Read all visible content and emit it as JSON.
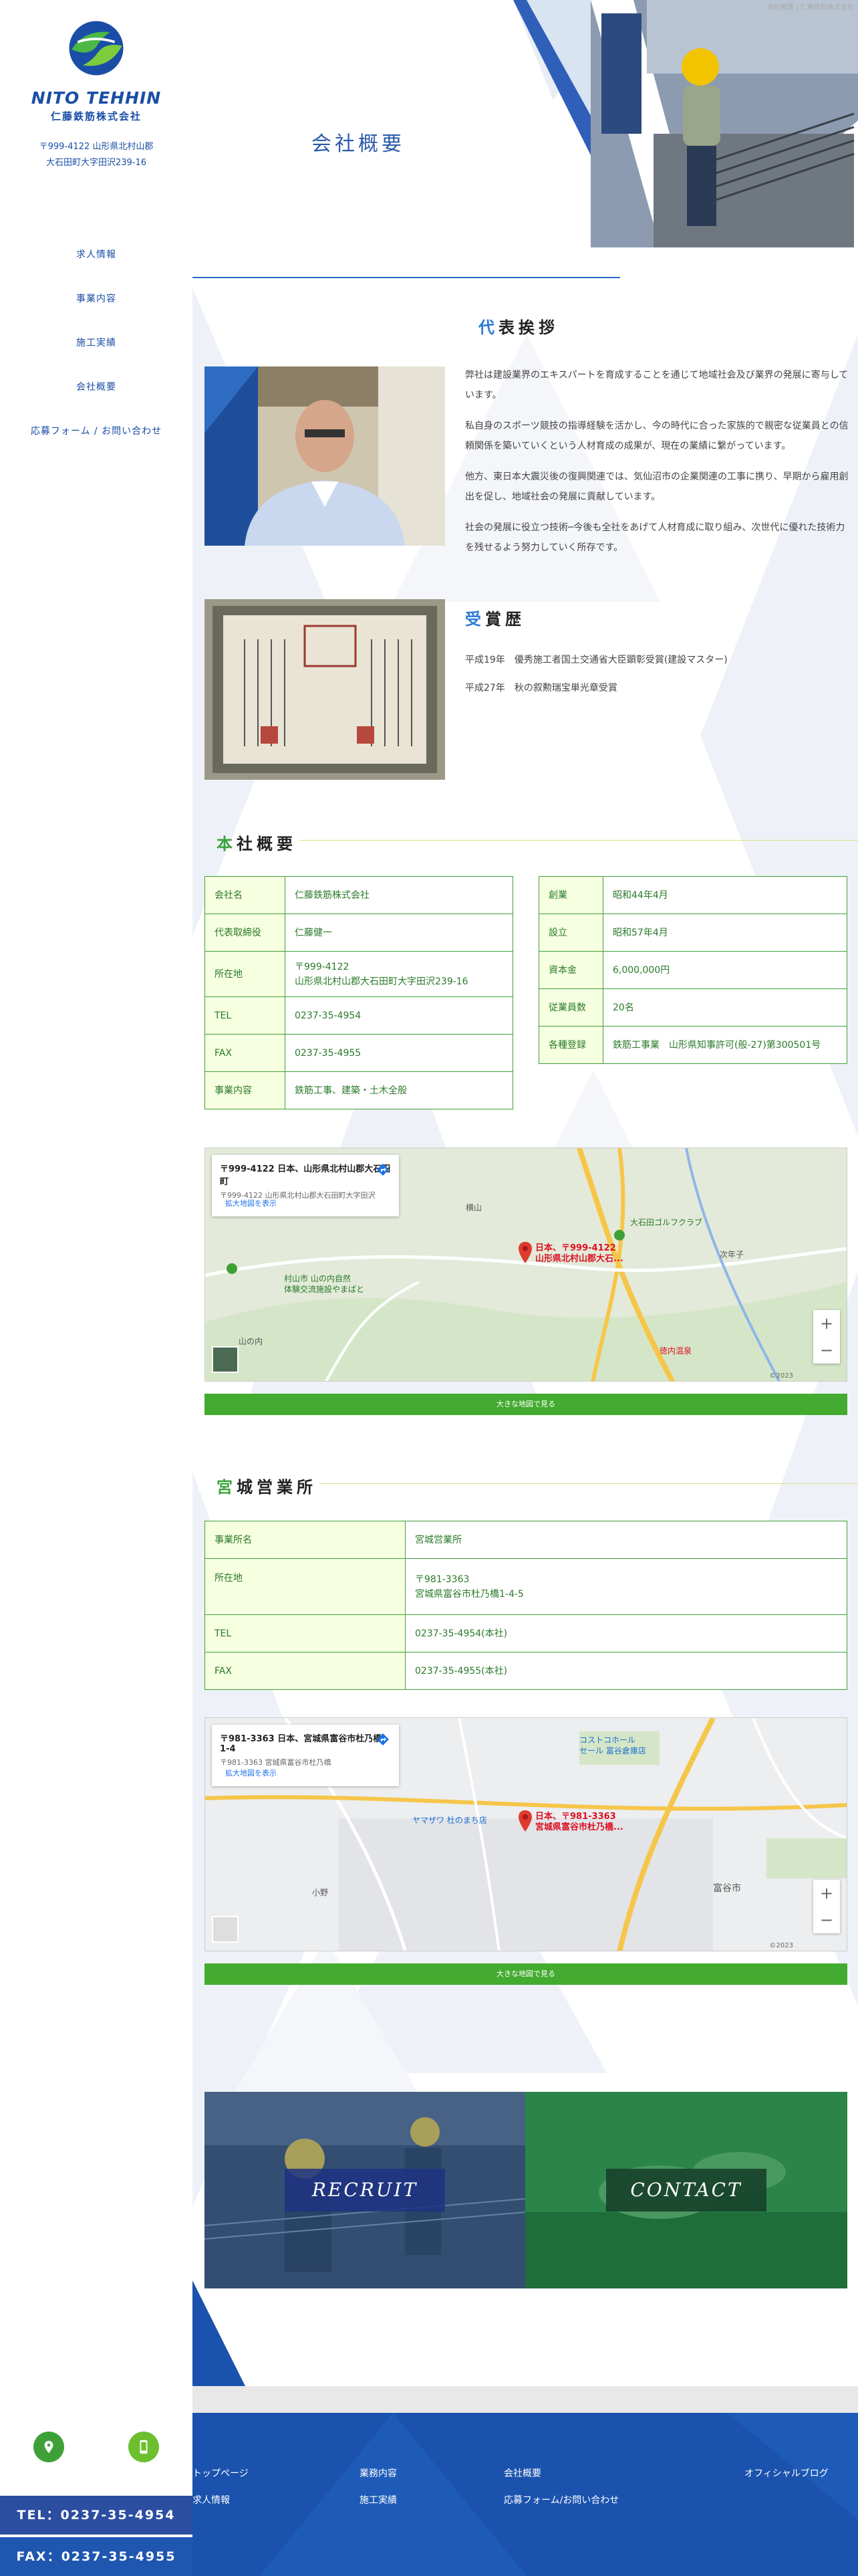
{
  "sidebar": {
    "logo_en": "NITO TEHHIN",
    "logo_jp": "仁藤鉄筋株式会社",
    "address_line1": "〒999-4122 山形県北村山郡",
    "address_line2": "大石田町大字田沢239-16",
    "nav": [
      {
        "label": "求人情報"
      },
      {
        "label": "事業内容"
      },
      {
        "label": "施工実績"
      },
      {
        "label": "会社概要"
      },
      {
        "label": "応募フォーム / お問い合わせ"
      }
    ],
    "tel": "TEL：0237-35-4954",
    "fax": "FAX：0237-35-4955"
  },
  "hero": {
    "title": "会社概要",
    "small": "会社概要 | 仁藤鉄筋株式会社"
  },
  "greeting": {
    "first": "代",
    "rest": "表挨拶",
    "paragraphs": [
      "弊社は建設業界のエキスパートを育成することを通じて地域社会及び業界の発展に寄与しています。",
      "私自身のスポーツ競技の指導経験を活かし、今の時代に合った家族的で親密な従業員との信頼関係を築いていくという人材育成の成果が、現在の業績に繋がっています。",
      "他方、東日本大震災後の復興関連では、気仙沼市の企業関連の工事に携り、早期から雇用創出を促し、地域社会の発展に貢献しています。",
      "社会の発展に役立つ技術─今後も全社をあげて人材育成に取り組み、次世代に優れた技術力を残せるよう努力していく所存です。"
    ]
  },
  "awards": {
    "first": "受",
    "rest": "賞歴",
    "items": [
      "平成19年　優秀施工者国土交通省大臣顕彰受賞(建設マスター)",
      "平成27年　秋の叙勲瑞宝単光章受賞"
    ]
  },
  "company": {
    "first": "本",
    "rest": "社概要",
    "left_rows": [
      {
        "k": "会社名",
        "v": "仁藤鉄筋株式会社"
      },
      {
        "k": "代表取締役",
        "v": "仁藤健一"
      },
      {
        "k": "所在地",
        "v": "〒999-4122",
        "v2": "山形県北村山郡大石田町大字田沢239-16"
      },
      {
        "k": "TEL",
        "v": "0237-35-4954"
      },
      {
        "k": "FAX",
        "v": "0237-35-4955"
      },
      {
        "k": "事業内容",
        "v": "鉄筋工事、建築・土木全般"
      }
    ],
    "right_rows": [
      {
        "k": "創業",
        "v": "昭和44年4月"
      },
      {
        "k": "設立",
        "v": "昭和57年4月"
      },
      {
        "k": "資本金",
        "v": "6,000,000円"
      },
      {
        "k": "従業員数",
        "v": "20名"
      },
      {
        "k": "各種登録",
        "v": "鉄筋工事業　山形県知事許可(般-27)第300501号"
      }
    ]
  },
  "map1": {
    "card_title": "〒999-4122 日本、山形県北村山郡大石田町",
    "card_sub": "〒999-4122 山形県北村山郡大石田町大字田沢",
    "card_link": "拡大地図を表示",
    "pin_label1": "日本、〒999-4122",
    "pin_label2": "山形県北村山郡大石...",
    "place1": "大石田ゴルフクラブ",
    "place2": "村山市 山の内自然",
    "place3": "体験交流施設やまばと",
    "place4": "山の内",
    "place5": "徳内温泉",
    "place6": "横山",
    "place7": "次年子",
    "attribution": "©2023",
    "button": "大きな地図で見る"
  },
  "branch": {
    "first": "宮",
    "rest": "城営業所",
    "rows": [
      {
        "k": "事業所名",
        "v": "宮城営業所"
      },
      {
        "k": "所在地",
        "v": "〒981-3363",
        "v2": "宮城県富谷市杜乃橋1-4-5"
      },
      {
        "k": "TEL",
        "v": "0237-35-4954(本社)"
      },
      {
        "k": "FAX",
        "v": "0237-35-4955(本社)"
      }
    ]
  },
  "map2": {
    "card_title": "〒981-3363 日本、宮城県富谷市杜乃橋1-4",
    "card_sub": "〒981-3363 宮城県富谷市杜乃橋",
    "card_link": "拡大地図を表示",
    "pin_label1": "日本、〒981-3363",
    "pin_label2": "宮城県富谷市杜乃橋...",
    "place1": "コストコホール",
    "place2": "セール 富谷倉庫店",
    "place3": "ヤマザワ 杜のまち店",
    "place4": "富谷市",
    "place5": "小野",
    "attribution": "©2023",
    "button": "大きな地図で見る"
  },
  "banners": {
    "recruit": "RECRUIT",
    "contact": "CONTACT"
  },
  "footer": {
    "links": [
      {
        "label": "トップページ"
      },
      {
        "label": "業務内容"
      },
      {
        "label": "会社概要"
      },
      {
        "label": "オフィシャルブログ"
      },
      {
        "label": "求人情報"
      },
      {
        "label": "施工実績"
      },
      {
        "label": "応募フォーム/お問い合わせ"
      }
    ]
  },
  "colors": {
    "brand_blue": "#1a4ea6",
    "brand_green": "#3ea137",
    "footer_blue": "#1a52ad"
  }
}
